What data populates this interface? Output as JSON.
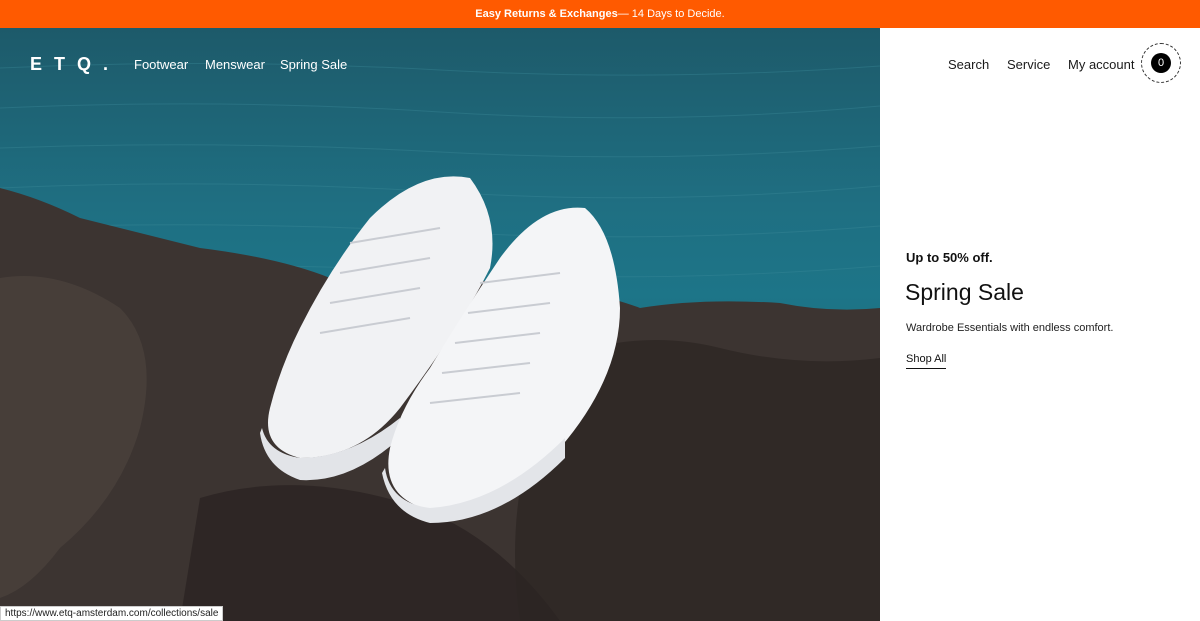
{
  "promo": {
    "bold": "Easy Returns & Exchanges",
    "rest": " — 14 Days to Decide."
  },
  "header": {
    "logo": "ETQ.",
    "nav": [
      "Footwear",
      "Menswear",
      "Spring Sale"
    ],
    "right": {
      "search": "Search",
      "service": "Service",
      "account": "My account"
    },
    "cart_count": "0"
  },
  "hero_panel": {
    "eyebrow": "Up to 50% off.",
    "title": "Spring Sale",
    "description": "Wardrobe Essentials with endless comfort.",
    "cta": "Shop All"
  },
  "status_bar": {
    "url": "https://www.etq-amsterdam.com/collections/sale"
  },
  "colors": {
    "accent": "#ff5a00",
    "panel": "#ffffff",
    "sea": "#1f6f82",
    "rock": "#3a3330"
  }
}
